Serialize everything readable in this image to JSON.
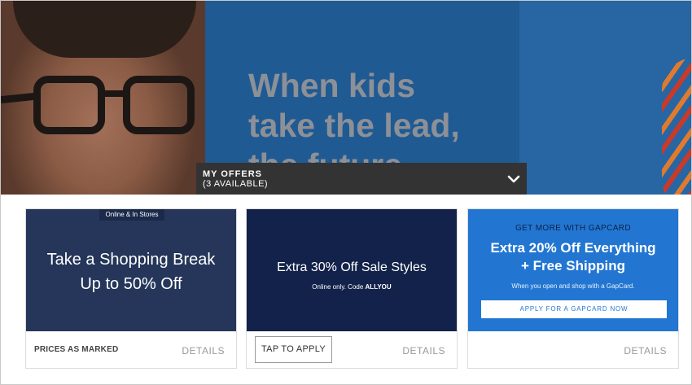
{
  "hero": {
    "headline": "When kids\ntake the lead,\nthe future"
  },
  "offers_bar": {
    "title": "MY OFFERS",
    "count": "(3 AVAILABLE)",
    "toggle_icon": "chevron-down-icon"
  },
  "offers": [
    {
      "badge": "Online & In Stores",
      "headline": "Take a Shopping Break\nUp to 50% Off",
      "footer_label": "PRICES AS MARKED",
      "details": "DETAILS"
    },
    {
      "headline": "Extra 30% Off Sale Styles",
      "sub": "Online only. Code ",
      "code": "ALLYOU",
      "button": "TAP TO APPLY",
      "details": "DETAILS"
    },
    {
      "eyebrow": "GET MORE WITH GAPCARD",
      "headline": "Extra 20% Off Everything\n+ Free Shipping",
      "sub": "When you open and shop with a GapCard.",
      "cta": "APPLY FOR A GAPCARD NOW",
      "details": "DETAILS"
    }
  ],
  "colors": {
    "hero_blue": "#1f5a93",
    "offers_bar": "#333333",
    "card1_bg": "#25365a",
    "card2_bg": "#13224a",
    "card3_bg": "#2276d2"
  }
}
